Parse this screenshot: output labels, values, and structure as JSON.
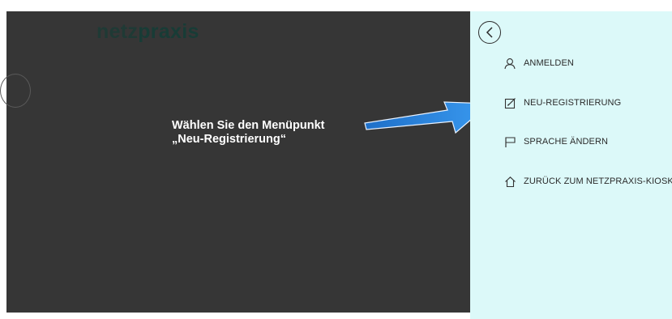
{
  "logo": {
    "part_a": "netz",
    "part_b": "praxis"
  },
  "callout": {
    "line1": "Wählen Sie den Menüpunkt",
    "line2": "„Neu-Registrierung“"
  },
  "menu": {
    "items": [
      {
        "label": "ANMELDEN",
        "icon": "user-icon"
      },
      {
        "label": "NEU-REGISTRIERUNG",
        "icon": "edit-icon"
      },
      {
        "label": "SPRACHE ÄNDERN",
        "icon": "flag-icon"
      },
      {
        "label": "ZURÜCK ZUM NETZPRAXIS-KIOSK",
        "icon": "home-icon"
      }
    ]
  },
  "colors": {
    "backdrop": "#363636",
    "panel": "#dcf9f9",
    "arrow": "#2b86dd",
    "logo": "#1f3a35"
  }
}
